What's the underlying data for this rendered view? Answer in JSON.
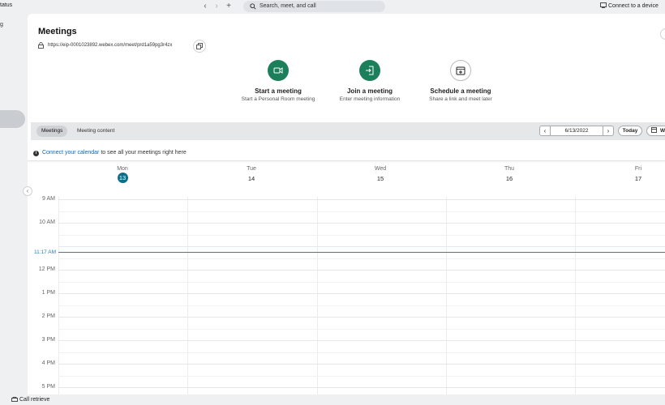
{
  "topbar": {
    "status_label": "tatus",
    "search_placeholder": "Search, meet, and call",
    "connect_device": "Connect to a device"
  },
  "leftnav": {
    "partial_label": "g"
  },
  "meetings": {
    "title": "Meetings",
    "url": "https://eip-0001023892.webex.com/meet/prd1a59pg3r4zx",
    "actions": [
      {
        "title": "Start a meeting",
        "subtitle": "Start a Personal Room meeting",
        "icon": "video-icon"
      },
      {
        "title": "Join a meeting",
        "subtitle": "Enter meeting information",
        "icon": "join-icon"
      },
      {
        "title": "Schedule a meeting",
        "subtitle": "Share a link and meet later",
        "icon": "calendar-add-icon"
      }
    ]
  },
  "tabs": {
    "meetings": "Meetings",
    "content": "Meeting content"
  },
  "datebar": {
    "date": "6/13/2022",
    "today": "Today",
    "view": "W"
  },
  "notice": {
    "link": "Connect your calendar",
    "text": " to see all your meetings right here"
  },
  "calendar": {
    "days": [
      {
        "name": "Mon",
        "num": "13",
        "today": true
      },
      {
        "name": "Tue",
        "num": "14",
        "today": false
      },
      {
        "name": "Wed",
        "num": "15",
        "today": false
      },
      {
        "name": "Thu",
        "num": "16",
        "today": false
      },
      {
        "name": "Fri",
        "num": "17",
        "today": false
      }
    ],
    "hours": [
      "9 AM",
      "10 AM",
      "11 AM",
      "12 PM",
      "1 PM",
      "2 PM",
      "3 PM",
      "4 PM",
      "5 PM"
    ],
    "now_label": "11:17 AM"
  },
  "footer": {
    "call_retrieve": "Call retrieve"
  },
  "colors": {
    "accent_green": "#1a7f5a",
    "today_blue": "#0f6c8c",
    "now_line": "#2b7fb3",
    "link": "#0a66c2"
  }
}
